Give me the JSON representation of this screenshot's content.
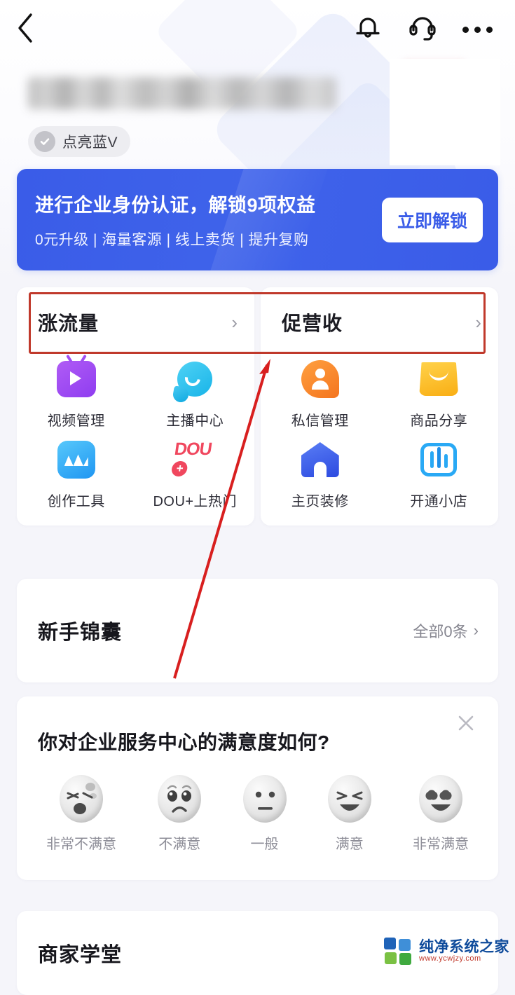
{
  "topbar": {
    "back_icon": "chevron-left-icon",
    "bell_icon": "bell-icon",
    "service_icon": "headset-icon",
    "more_icon": "more-dots-icon"
  },
  "profile": {
    "name_masked": "",
    "verify_label": "点亮蓝V",
    "verify_icon": "check-circle-icon"
  },
  "banner": {
    "title": "进行企业身份认证，解锁9项权益",
    "subtitle": "0元升级 | 海量客源 | 线上卖货 | 提升复购",
    "button_label": "立即解锁",
    "accent_color": "#3a5ce8"
  },
  "cards": [
    {
      "title": "涨流量",
      "chevron": "›",
      "items": [
        {
          "label": "视频管理",
          "icon": "video-manage-icon"
        },
        {
          "label": "主播中心",
          "icon": "anchor-center-icon"
        },
        {
          "label": "创作工具",
          "icon": "creation-tool-icon"
        },
        {
          "label": "DOU+上热门",
          "icon": "dou-plus-icon"
        }
      ]
    },
    {
      "title": "促营收",
      "chevron": "›",
      "items": [
        {
          "label": "私信管理",
          "icon": "direct-message-icon"
        },
        {
          "label": "商品分享",
          "icon": "product-share-icon"
        },
        {
          "label": "主页装修",
          "icon": "homepage-decorate-icon"
        },
        {
          "label": "开通小店",
          "icon": "open-shop-icon"
        }
      ]
    }
  ],
  "novice": {
    "title": "新手锦囊",
    "more_label": "全部0条",
    "chevron": "›"
  },
  "survey": {
    "question": "你对企业服务中心的满意度如何?",
    "close_icon": "close-icon",
    "options": [
      {
        "label": "非常不满意",
        "face": "angry-face"
      },
      {
        "label": "不满意",
        "face": "sad-face"
      },
      {
        "label": "一般",
        "face": "neutral-face"
      },
      {
        "label": "满意",
        "face": "happy-face"
      },
      {
        "label": "非常满意",
        "face": "heart-eyes-face"
      }
    ]
  },
  "school": {
    "title": "商家学堂"
  },
  "annotation": {
    "rect_color": "#c0392b",
    "arrow_color": "#d81f1f"
  },
  "watermark": {
    "title": "纯净系统之家",
    "url": "www.ycwjzy.com"
  }
}
